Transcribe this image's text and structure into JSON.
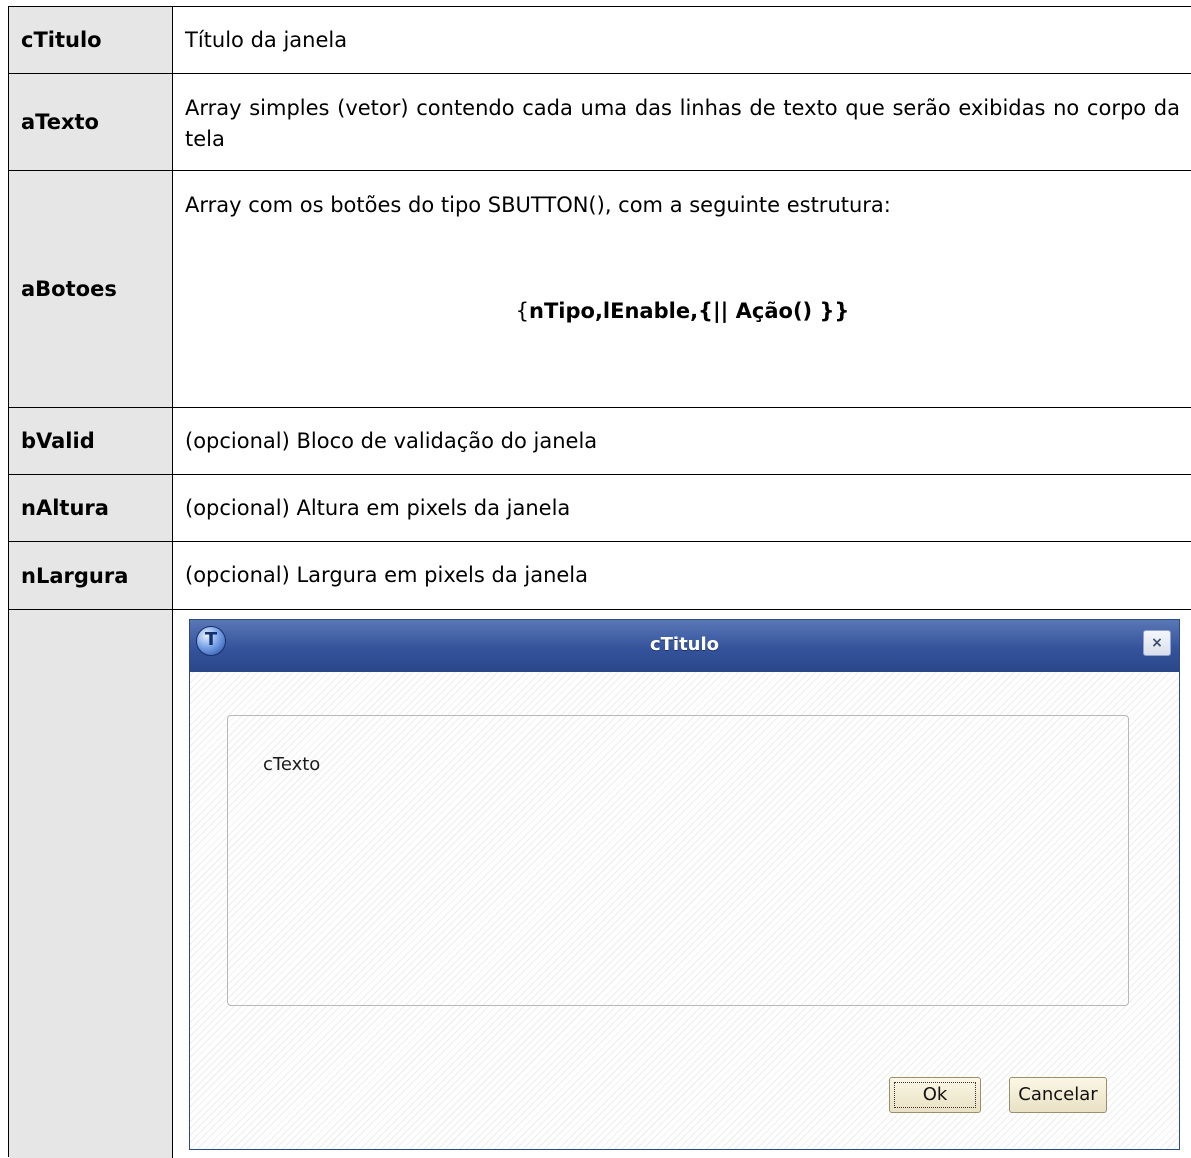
{
  "params": [
    {
      "name": "cTitulo",
      "desc": "Título da janela"
    },
    {
      "name": "aTexto",
      "desc": "Array simples (vetor) contendo cada uma das linhas de texto que serão exibidas no corpo da tela"
    },
    {
      "name": "aBotoes",
      "desc": "Array com os botões do tipo SBUTTON(), com a seguinte estrutura:",
      "code_brace": "{",
      "code": "nTipo,lEnable,{|| Ação() }}"
    },
    {
      "name": "bValid",
      "desc": "(opcional) Bloco de validação do janela"
    },
    {
      "name": "nAltura",
      "desc": "(opcional) Altura em pixels da janela"
    },
    {
      "name": "nLargura",
      "desc": "(opcional) Largura em pixels da janela"
    }
  ],
  "dialog": {
    "icon_letter": "T",
    "title": "cTitulo",
    "close_glyph": "×",
    "body_text": "cTexto",
    "ok_label": "Ok",
    "cancel_label": "Cancelar"
  },
  "colors": {
    "name_cell_bg": "#e6e6e6",
    "titlebar": "#34539c",
    "button_bg": "#f4efd8"
  }
}
